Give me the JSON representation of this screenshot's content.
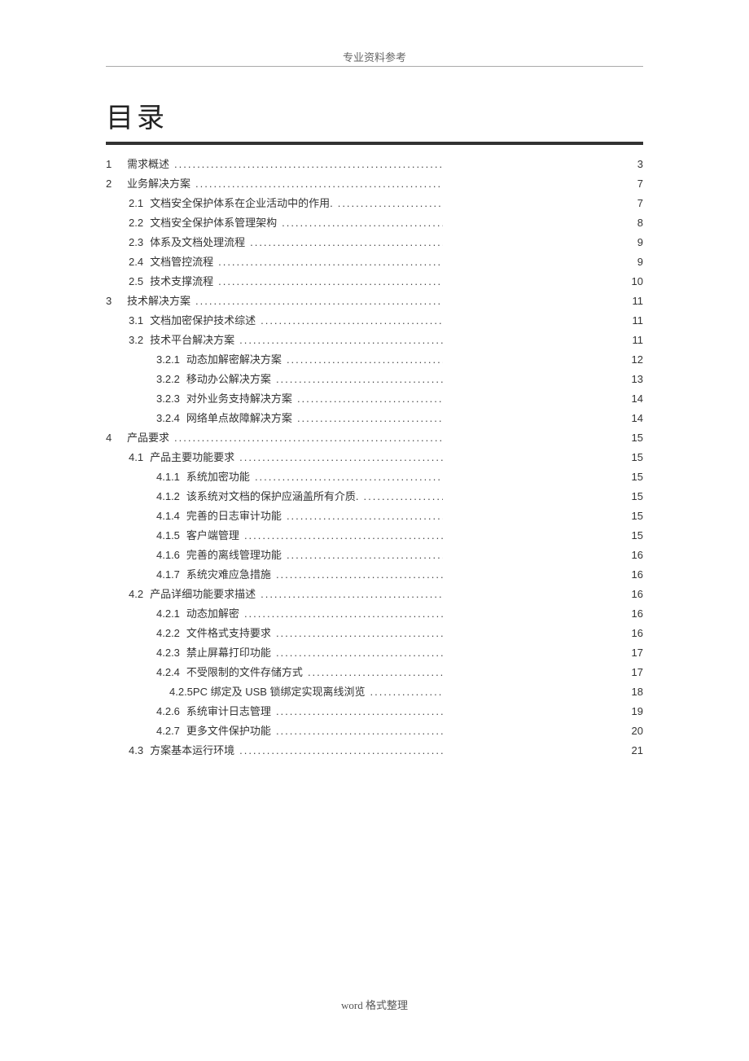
{
  "header_note": "专业资料参考",
  "title": "目录",
  "footer_note": "word 格式整理",
  "toc": [
    {
      "level": 1,
      "num": "1",
      "label": "需求概述",
      "page": "3"
    },
    {
      "level": 1,
      "num": "2",
      "label": "业务解决方案",
      "page": "7"
    },
    {
      "level": 2,
      "num": "2.1",
      "label": "文档安全保护体系在企业活动中的作用.",
      "page": "7"
    },
    {
      "level": 2,
      "num": "2.2",
      "label": "文档安全保护体系管理架构",
      "page": "8"
    },
    {
      "level": 2,
      "num": "2.3",
      "label": "体系及文档处理流程",
      "page": "9"
    },
    {
      "level": 2,
      "num": "2.4",
      "label": "文档管控流程",
      "page": "9"
    },
    {
      "level": 2,
      "num": "2.5",
      "label": "技术支撑流程",
      "page": "10"
    },
    {
      "level": 1,
      "num": "3",
      "label": "技术解决方案",
      "page": "11"
    },
    {
      "level": 2,
      "num": "3.1",
      "label": "文档加密保护技术综述",
      "page": "11"
    },
    {
      "level": 2,
      "num": "3.2",
      "label": "技术平台解决方案",
      "page": "11"
    },
    {
      "level": 3,
      "num": "3.2.1",
      "label": "动态加解密解决方案",
      "page": "12"
    },
    {
      "level": 3,
      "num": "3.2.2",
      "label": "移动办公解决方案",
      "page": "13"
    },
    {
      "level": 3,
      "num": "3.2.3",
      "label": "对外业务支持解决方案",
      "page": "14"
    },
    {
      "level": 3,
      "num": "3.2.4",
      "label": "网络单点故障解决方案",
      "page": "14"
    },
    {
      "level": 1,
      "num": "4",
      "label": "产品要求",
      "page": "15"
    },
    {
      "level": 2,
      "num": "4.1",
      "label": "产品主要功能要求",
      "page": "15"
    },
    {
      "level": 3,
      "num": "4.1.1",
      "label": "系统加密功能",
      "page": "15"
    },
    {
      "level": 3,
      "num": "4.1.2",
      "label": "该系统对文档的保护应涵盖所有介质.",
      "page": "15"
    },
    {
      "level": 3,
      "num": "4.1.4",
      "label": "完善的日志审计功能",
      "page": "15"
    },
    {
      "level": 3,
      "num": "4.1.5",
      "label": "客户端管理",
      "page": "15"
    },
    {
      "level": 3,
      "num": "4.1.6",
      "label": "完善的离线管理功能",
      "page": "16"
    },
    {
      "level": 3,
      "num": "4.1.7",
      "label": "系统灾难应急措施",
      "page": "16"
    },
    {
      "level": 2,
      "num": "4.2",
      "label": "产品详细功能要求描述",
      "page": "16"
    },
    {
      "level": 3,
      "num": "4.2.1",
      "label": "动态加解密",
      "page": "16"
    },
    {
      "level": 3,
      "num": "4.2.2",
      "label": "文件格式支持要求",
      "page": "16"
    },
    {
      "level": 3,
      "num": "4.2.3",
      "label": "禁止屏幕打印功能",
      "page": "17"
    },
    {
      "level": 3,
      "num": "4.2.4",
      "label": "不受限制的文件存储方式",
      "page": "17"
    },
    {
      "level": 3,
      "num": "",
      "label": "4.2.5PC 绑定及  USB 锁绑定实现离线浏览",
      "page": "18"
    },
    {
      "level": 3,
      "num": "4.2.6",
      "label": "系统审计日志管理",
      "page": "19"
    },
    {
      "level": 3,
      "num": "4.2.7",
      "label": "更多文件保护功能",
      "page": "20"
    },
    {
      "level": 2,
      "num": "4.3",
      "label": "方案基本运行环境",
      "page": "21"
    }
  ]
}
